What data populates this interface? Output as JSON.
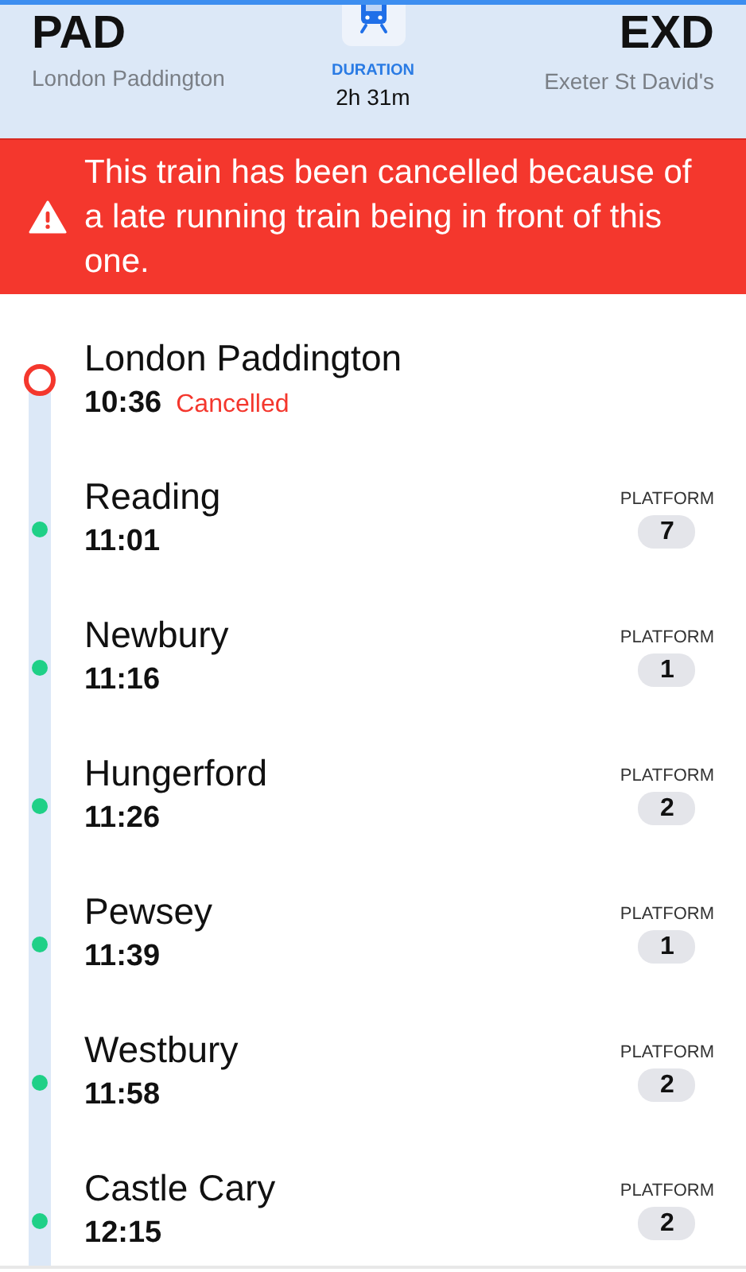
{
  "journey": {
    "origin": {
      "code": "PAD",
      "name": "London Paddington"
    },
    "duration": {
      "label": "DURATION",
      "value": "2h 31m"
    },
    "destination": {
      "code": "EXD",
      "name": "Exeter St David's"
    }
  },
  "alert": {
    "message": "This train has been cancelled because of a late running train being in front of this one."
  },
  "stops": [
    {
      "name": "London Paddington",
      "time": "10:36",
      "cancelled": true,
      "status": "Cancelled"
    },
    {
      "name": "Reading",
      "time": "11:01",
      "cancelled": false,
      "platform_label": "PLATFORM",
      "platform": "7"
    },
    {
      "name": "Newbury",
      "time": "11:16",
      "cancelled": false,
      "platform_label": "PLATFORM",
      "platform": "1"
    },
    {
      "name": "Hungerford",
      "time": "11:26",
      "cancelled": false,
      "platform_label": "PLATFORM",
      "platform": "2"
    },
    {
      "name": "Pewsey",
      "time": "11:39",
      "cancelled": false,
      "platform_label": "PLATFORM",
      "platform": "1"
    },
    {
      "name": "Westbury",
      "time": "11:58",
      "cancelled": false,
      "platform_label": "PLATFORM",
      "platform": "2"
    },
    {
      "name": "Castle Cary",
      "time": "12:15",
      "cancelled": false,
      "platform_label": "PLATFORM",
      "platform": "2"
    }
  ]
}
